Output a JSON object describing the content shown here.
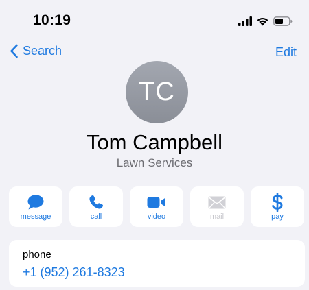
{
  "status_bar": {
    "time": "10:19"
  },
  "nav": {
    "back_label": "Search",
    "edit_label": "Edit"
  },
  "contact": {
    "initials": "TC",
    "name": "Tom Campbell",
    "company": "Lawn Services"
  },
  "actions": [
    {
      "label": "message",
      "icon": "message-bubble-icon",
      "enabled": true
    },
    {
      "label": "call",
      "icon": "phone-icon",
      "enabled": true
    },
    {
      "label": "video",
      "icon": "video-camera-icon",
      "enabled": true
    },
    {
      "label": "mail",
      "icon": "envelope-icon",
      "enabled": false
    },
    {
      "label": "pay",
      "icon": "dollar-icon",
      "enabled": true
    }
  ],
  "phone": {
    "label": "phone",
    "number": "+1 (952) 261-8323"
  },
  "colors": {
    "accent": "#1f7ae0",
    "background": "#f2f2f7",
    "disabled": "#c7c7cc",
    "avatar": "#9a9ea7"
  }
}
